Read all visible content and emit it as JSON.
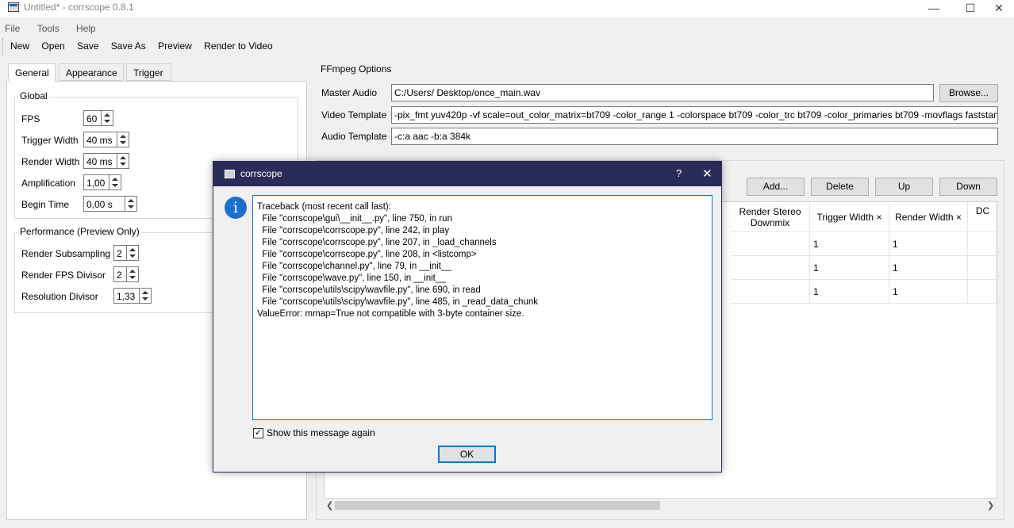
{
  "window": {
    "title": "Untitled* - corrscope 0.8.1",
    "controls": [
      "—",
      "☐",
      "✕"
    ]
  },
  "menu": [
    "File",
    "Tools",
    "Help"
  ],
  "toolbar": [
    "New",
    "Open",
    "Save",
    "Save As",
    "Preview",
    "Render to Video"
  ],
  "tabs": [
    "General",
    "Appearance",
    "Trigger"
  ],
  "global": {
    "title": "Global",
    "fields": [
      {
        "label": "FPS",
        "value": "60"
      },
      {
        "label": "Trigger Width",
        "value": "40 ms"
      },
      {
        "label": "Render Width",
        "value": "40 ms"
      },
      {
        "label": "Amplification",
        "value": "1,00"
      },
      {
        "label": "Begin Time",
        "value": "0,00 s"
      }
    ]
  },
  "performance": {
    "title": "Performance (Preview Only)",
    "fields": [
      {
        "label": "Render Subsampling",
        "value": "2"
      },
      {
        "label": "Render FPS Divisor",
        "value": "2"
      },
      {
        "label": "Resolution Divisor",
        "value": "1,33"
      }
    ]
  },
  "ffmpeg": {
    "title": "FFmpeg Options",
    "master_audio_label": "Master Audio",
    "master_audio_value": "C:/Users/                 Desktop/once_main.wav",
    "browse_label": "Browse...",
    "video_template_label": "Video Template",
    "video_template_value": "-pix_fmt yuv420p -vf scale=out_color_matrix=bt709 -color_range 1 -colorspace bt709 -color_trc bt709 -color_primaries bt709 -movflags faststart",
    "audio_template_label": "Audio Template",
    "audio_template_value": "-c:a aac -b:a 384k"
  },
  "channels": {
    "buttons": [
      "Add...",
      "Delete",
      "Up",
      "Down"
    ],
    "columns": [
      "Render Stereo\nDownmix",
      "Trigger Width ×",
      "Render Width ×",
      "DC"
    ],
    "rows": [
      {
        "trigger_width": "1",
        "render_width": "1"
      },
      {
        "trigger_width": "1",
        "render_width": "1"
      },
      {
        "trigger_width": "1",
        "render_width": "1"
      }
    ]
  },
  "dialog": {
    "title": "corrscope",
    "help": "?",
    "close": "✕",
    "traceback": "Traceback (most recent call last):\n  File \"corrscope\\gui\\__init__.py\", line 750, in run\n  File \"corrscope\\corrscope.py\", line 242, in play\n  File \"corrscope\\corrscope.py\", line 207, in _load_channels\n  File \"corrscope\\corrscope.py\", line 208, in <listcomp>\n  File \"corrscope\\channel.py\", line 79, in __init__\n  File \"corrscope\\wave.py\", line 150, in __init__\n  File \"corrscope\\utils\\scipy\\wavfile.py\", line 690, in read\n  File \"corrscope\\utils\\scipy\\wavfile.py\", line 485, in _read_data_chunk\nValueError: mmap=True not compatible with 3-byte container size.",
    "checkbox_label": "Show this message again",
    "checkbox_checked": true,
    "ok_label": "OK"
  },
  "colors": {
    "dialog_titlebar": "#2b2b5a",
    "info_icon": "#1c6fd1",
    "focus": "#0078d7"
  }
}
